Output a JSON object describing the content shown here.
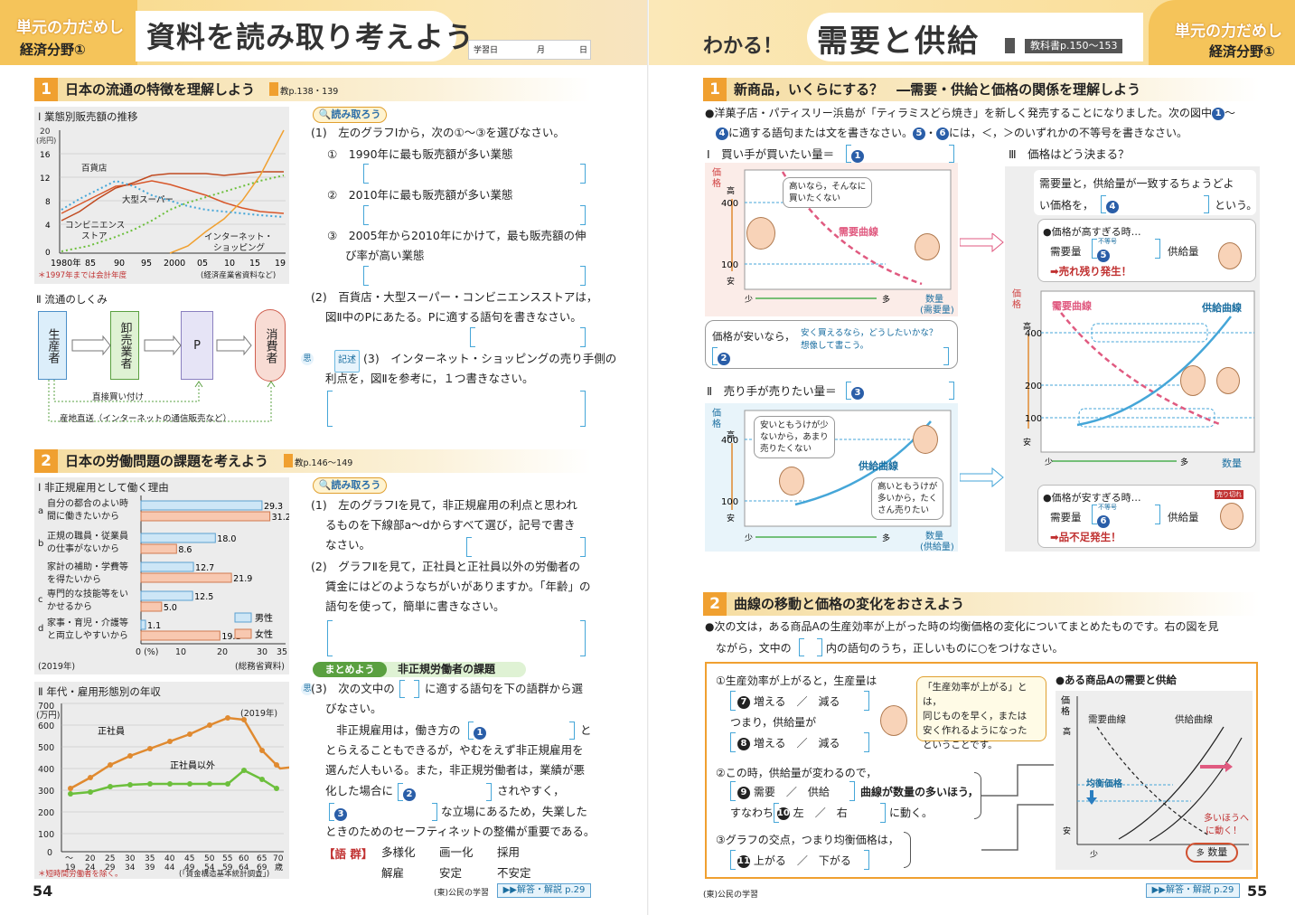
{
  "left_page": {
    "header": {
      "tab_line1": "単元の力だめし",
      "tab_line2": "経済分野①",
      "title": "資料を読み取り考えよう",
      "date_label": "学習日",
      "month": "月",
      "day": "日"
    },
    "section1": {
      "num": "1",
      "title": "日本の流通の特徴を理解しよう",
      "ref": "教p.138・139",
      "chart1": {
        "title": "Ⅰ 業態別販売額の推移",
        "unit": "(兆円)",
        "note": "＊1997年までは会計年度",
        "source": "(経済産業省資料など)",
        "lbl_dept": "百貨店",
        "lbl_super": "大型スーパー",
        "lbl_conv1": "コンビニエンス",
        "lbl_conv2": "ストア",
        "lbl_net1": "インターネット・",
        "lbl_net2": "ショッピング"
      },
      "chart2": {
        "title": "Ⅱ 流通のしくみ",
        "box1": "生産者",
        "box2": "卸売業者",
        "box3": "P",
        "box4": "消費者",
        "line1": "直接買い付け",
        "line2": "産地直送（インターネットの通信販売など）"
      },
      "read_tag": "読み取ろう",
      "q1": "(1)　左のグラフⅠから，次の①〜③を選びなさい。",
      "q1_1": "①　1990年に最も販売額が多い業態",
      "q1_2": "②　2010年に最も販売額が多い業態",
      "q1_3a": "③　2005年から2010年にかけて，最も販売額の伸",
      "q1_3b": "び率が高い業態",
      "q2a": "(2)　百貨店・大型スーパー・コンビニエンスストアは，",
      "q2b": "図Ⅱ中のPにあたる。Pに適する語句を書きなさい。",
      "q3_mark": "思",
      "q3_tag": "記述",
      "q3a": "(3)　インターネット・ショッピングの売り手側の",
      "q3b": "利点を，図Ⅱを参考に，１つ書きなさい。"
    },
    "section2": {
      "num": "2",
      "title": "日本の労働問題の課題を考えよう",
      "ref": "教p.146〜149",
      "chart1": {
        "title": "Ⅰ 非正規雇用として働く理由",
        "year": "(2019年)",
        "source": "(総務省資料)",
        "legend_m": "男性",
        "legend_f": "女性"
      },
      "chart2": {
        "title": "Ⅱ 年代・雇用形態別の年収",
        "unit1": "(万円)",
        "year": "(2019年)",
        "lbl_regular": "正社員",
        "lbl_other": "正社員以外",
        "note": "＊短時間労働者を除く。",
        "source": "(「賃金構造基本統計調査」)"
      },
      "read_tag": "読み取ろう",
      "q1a": "(1)　左のグラフⅠを見て，非正規雇用の利点と思われ",
      "q1b": "るものを下線部a〜dからすべて選び，記号で書き",
      "q1c": "なさい。",
      "q2a": "(2)　グラフⅡを見て，正社員と正社員以外の労働者の",
      "q2b": "賃金にはどのようなちがいがありますか。「年齢」の",
      "q2c": "語句を使って，簡単に書きなさい。",
      "summary_tag": "まとめよう",
      "summary_title": "非正規労働者の課題",
      "q3_mark": "思",
      "q3a": "(3)　次の文中の",
      "q3a2": "に適する語句を下の語群から選",
      "q3b": "びなさい。",
      "p1": "非正規雇用は，働き方の",
      "p1b": "と",
      "p2": "とらえることもできるが，やむをえず非正規雇用を",
      "p3": "選んだ人もいる。また，非正規労働者は，業績が悪",
      "p4": "化した場合に",
      "p4b": "されやすく，",
      "p5b": "な立場にあるため，失業した",
      "p6": "ときのためのセーフティネットの整備が重要である。",
      "word_label": "【語 群】",
      "words": [
        "多様化",
        "画一化",
        "採用",
        "解雇",
        "安定",
        "不安定"
      ]
    },
    "footer": {
      "page": "54",
      "pub": "(東)公民の学習",
      "answer": "▶▶解答・解説 p.29"
    }
  },
  "right_page": {
    "header": {
      "wakaru": "わかる！",
      "title": "需要と供給",
      "ref": "教科書p.150〜153",
      "tab_line1": "単元の力だめし",
      "tab_line2": "経済分野①"
    },
    "section1": {
      "num": "1",
      "title": "新商品，いくらにする？　―需要・供給と価格の関係を理解しよう",
      "intro1": "●洋菓子店・パティスリー浜島が「ティラミスどら焼き」を新しく発売することになりました。次の図中",
      "intro1b": "〜",
      "intro2": "に適する語句または文を書きなさい。",
      "intro2b": "には，＜，＞のいずれかの不等号を書きなさい。",
      "g1_title": "Ⅰ　買い手が買いたい量＝",
      "g1_bubble1": "高いなら，そんなに",
      "g1_bubble2": "買いたくない",
      "g1_curve": "需要曲線",
      "g1_xlabel1": "数量",
      "g1_xlabel2": "(需要量)",
      "g1_q": "価格が安いなら，",
      "g1_hint1": "安く買えるなら，どうしたいかな？",
      "g1_hint2": "想像して書こう。",
      "g2_title": "Ⅱ　売り手が売りたい量＝",
      "g2_bubble1": "安いともうけが少",
      "g2_bubble2": "ないから，あまり",
      "g2_bubble3": "売りたくない",
      "g2_bubble4": "高いともうけが",
      "g2_bubble5": "多いから，たく",
      "g2_bubble6": "さん売りたい",
      "g2_curve": "供給曲線",
      "g2_xlabel1": "数量",
      "g2_xlabel2": "(供給量)",
      "price_axis": "価格",
      "high": "高",
      "low": "安",
      "few": "少",
      "many": "多",
      "v400": "400",
      "v200": "200",
      "v100": "100",
      "g3_title": "Ⅲ　価格はどう決まる？",
      "g3_text1": "需要量と，供給量が一致するちょうどよ",
      "g3_text2": "い価格を，",
      "g3_text2b": "という。",
      "g3_high": "●価格が高すぎる時…",
      "g3_demand": "需要量",
      "g3_ineq": "不等号",
      "g3_supply": "供給量",
      "g3_result1": "➡売れ残り発生！",
      "g3_low": "●価格が安すぎる時…",
      "g3_result2": "➡品不足発生！",
      "g3_dcurve": "需要曲線",
      "g3_scurve": "供給曲線",
      "g3_xlabel": "数量",
      "sold_out": "売り切れ"
    },
    "section2": {
      "num": "2",
      "title": "曲線の移動と価格の変化をおさえよう",
      "intro1": "●次の文は，ある商品Aの生産効率が上がった時の均衡価格の変化についてまとめたものです。右の図を見",
      "intro2": "ながら，文中の",
      "intro2b": "内の語句のうち，正しいものに○をつけなさい。",
      "s1": "①生産効率が上がると，生産量は",
      "s1_a": "増える",
      "s1_b": "減る",
      "s1c": "つまり，供給量が",
      "s2_a": "増える",
      "s2_b": "減る",
      "tip1": "「生産効率が上がる」とは，",
      "tip2": "同じものを早く，または",
      "tip3": "安く作れるようになった",
      "tip4": "ということです。",
      "s2": "②この時，供給量が変わるので，",
      "s3_a": "需要",
      "s3_b": "供給",
      "s3c": "曲線が数量の多いほう，",
      "s4": "すなわち",
      "s4_a": "左",
      "s4_b": "右",
      "s4c": "に動く。",
      "s3": "③グラフの交点，つまり均衡価格は，",
      "s5_a": "上がる",
      "s5_b": "下がる",
      "chart_title": "●ある商品Aの需要と供給",
      "c_price": "価格",
      "c_high": "高",
      "c_low": "安",
      "c_few": "少",
      "c_qty": "数量",
      "c_many": "多",
      "c_dcurve": "需要曲線",
      "c_scurve": "供給曲線",
      "c_eq": "均衡価格",
      "c_move1": "多いほうへ",
      "c_move2": "に動く！",
      "slash": "／"
    },
    "footer": {
      "pub": "(東)公民の学習",
      "answer": "▶▶解答・解説 p.29",
      "page": "55"
    }
  }
}
